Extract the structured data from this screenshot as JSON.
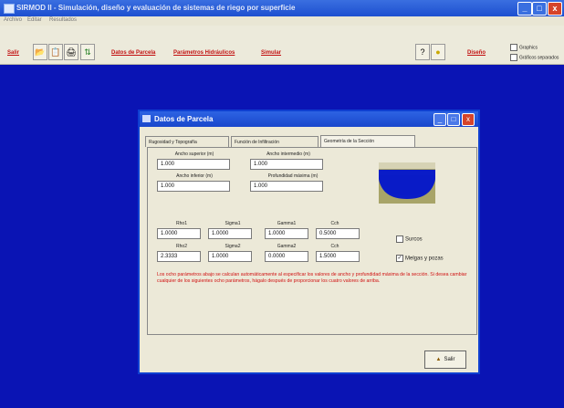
{
  "window": {
    "title": "SIRMOD II - Simulación, diseño y evaluación de sistemas de riego por superficie",
    "minimize": "_",
    "maximize": "□",
    "close": "x"
  },
  "menu": [
    "Archivo",
    "Editar",
    "Resultados"
  ],
  "toolbar": {
    "exit_label": "Salir",
    "links": [
      "Datos de Parcela",
      "Parámetros Hidráulicos",
      "Simular",
      "Diseño"
    ],
    "checkboxes": [
      "Graphics",
      "Gráficos separados"
    ]
  },
  "dialog": {
    "title": "Datos de Parcela",
    "minimize": "_",
    "maximize": "□",
    "close": "x",
    "tabs": [
      "Rugosidad y Topografía",
      "Función de Infiltración",
      "Geometría de la Sección"
    ],
    "fields": {
      "ancho_superior": {
        "label": "Ancho superior (m)",
        "value": "1.000"
      },
      "ancho_intermedio": {
        "label": "Ancho intermedio (m)",
        "value": "1.000"
      },
      "ancho_inferior": {
        "label": "Ancho inferior (m)",
        "value": "1.000"
      },
      "profundidad_maxima": {
        "label": "Profundidad máxima (m)",
        "value": "1.000"
      }
    },
    "params_row1": [
      {
        "label": "Rho1",
        "value": "1.0000"
      },
      {
        "label": "Sigma1",
        "value": "1.0000"
      },
      {
        "label": "Gamma1",
        "value": "1.0000"
      },
      {
        "label": "Cch",
        "value": "0.5000"
      }
    ],
    "params_row2": [
      {
        "label": "Rho2",
        "value": "2.3333"
      },
      {
        "label": "Sigma2",
        "value": "1.0000"
      },
      {
        "label": "Gamma2",
        "value": "0.0000"
      },
      {
        "label": "Cch",
        "value": "1.5000"
      }
    ],
    "options": {
      "surcos": {
        "label": "Surcos",
        "checked": false
      },
      "melgas": {
        "label": "Melgas y pozas",
        "checked": true
      }
    },
    "warning": "Los ocho parámetros abajo se calculan automáticamente al especificar los valores de ancho y profundidad máxima de la sección. Si desea cambiar cualquier de los siguientes ocho parámetros, hágalo después de proporcionar los cuatro valores de arriba.",
    "ok_label": "Salir",
    "colors": {
      "water": "#0a1cc8",
      "soil": "#a8a468"
    }
  }
}
